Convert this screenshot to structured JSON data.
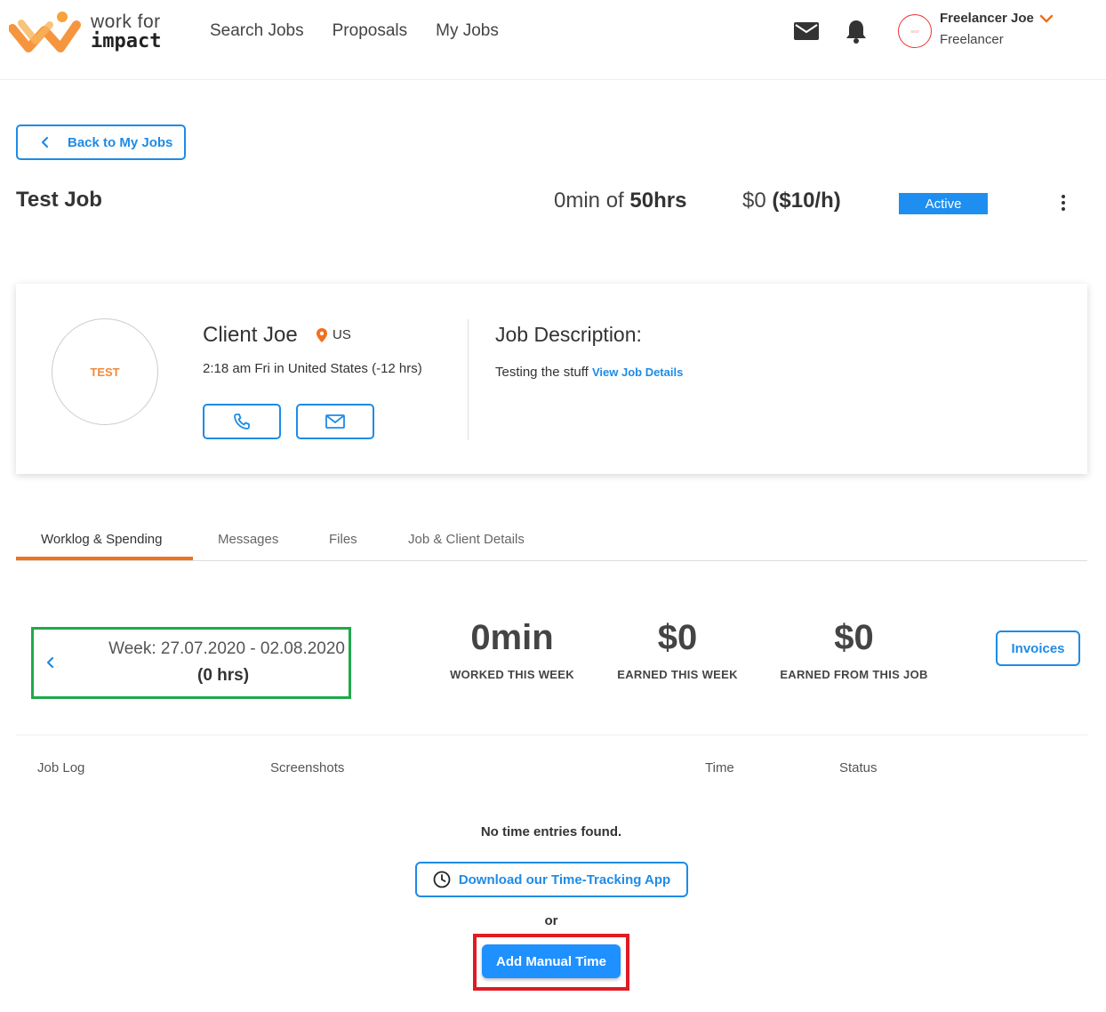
{
  "header": {
    "logo": {
      "line1": "work for",
      "line2": "impact"
    },
    "nav": [
      "Search Jobs",
      "Proposals",
      "My Jobs"
    ],
    "user": {
      "name": "Freelancer Joe",
      "role": "Freelancer",
      "avatar_text": "TEST"
    }
  },
  "back_button": "Back to My Jobs",
  "job": {
    "title": "Test Job",
    "hours_used": "0min of",
    "hours_total": "50hrs",
    "amount": "$0",
    "rate": "($10/h)",
    "status": "Active"
  },
  "client": {
    "avatar_text": "TEST",
    "name": "Client Joe",
    "location": "US",
    "local_time": "2:18 am Fri in United States (-12 hrs)"
  },
  "description": {
    "title": "Job Description:",
    "text": "Testing the stuff",
    "link": "View Job Details"
  },
  "tabs": [
    "Worklog & Spending",
    "Messages",
    "Files",
    "Job & Client Details"
  ],
  "week": {
    "label": "Week: 27.07.2020 - 02.08.2020",
    "hours": "(0 hrs)"
  },
  "stats": [
    {
      "value": "0min",
      "label": "WORKED THIS WEEK"
    },
    {
      "value": "$0",
      "label": "EARNED THIS WEEK"
    },
    {
      "value": "$0",
      "label": "EARNED FROM THIS JOB"
    }
  ],
  "invoices_button": "Invoices",
  "log_columns": [
    "Job Log",
    "Screenshots",
    "Time",
    "Status"
  ],
  "empty_message": "No time entries found.",
  "download_button": "Download our Time-Tracking App",
  "or_text": "or",
  "manual_button": "Add Manual Time",
  "colors": {
    "accent": "#1e8be6",
    "brand_orange": "#f07020",
    "highlight_green": "#1fa84a",
    "highlight_red": "#e01b24"
  }
}
